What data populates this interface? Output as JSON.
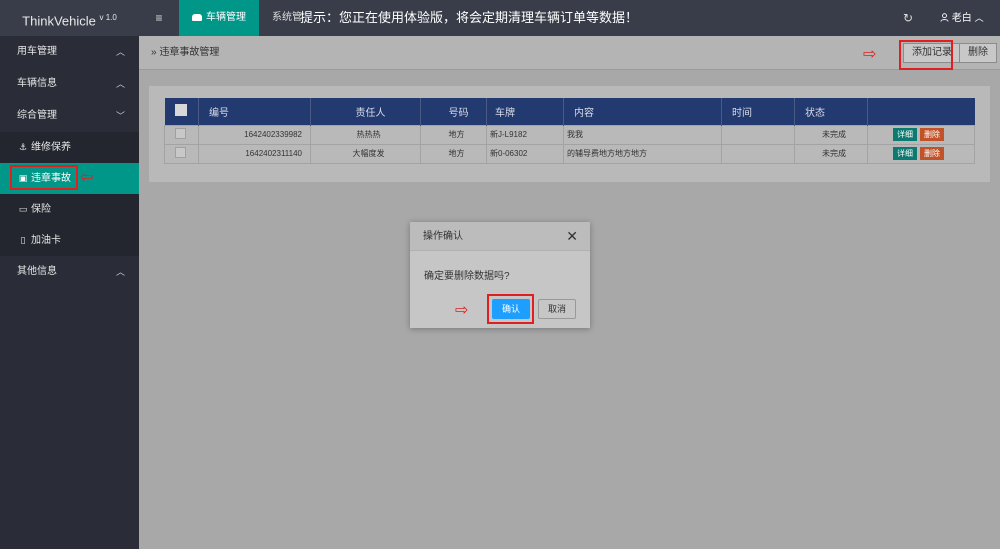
{
  "header": {
    "brand": "ThinkVehicle",
    "version": "v 1.0",
    "menu_icon": "≡",
    "active_tab": "车辆管理",
    "tab_sys": "系统管",
    "notice": "提示：您正在使用体验版，将会定期清理车辆订单等数据！",
    "refresh_icon": "↻",
    "user_name": "老白",
    "user_icon": "user-icon"
  },
  "sidebar": {
    "groups": [
      {
        "label": "用车管理",
        "chev": "︿"
      },
      {
        "label": "车辆信息",
        "chev": "︿"
      },
      {
        "label": "综合管理",
        "chev": "﹀"
      }
    ],
    "subs": [
      {
        "label": "维修保养",
        "icon": "⚓"
      },
      {
        "label": "违章事故",
        "icon": "▣"
      },
      {
        "label": "保险",
        "icon": "▭"
      },
      {
        "label": "加油卡",
        "icon": "▯"
      }
    ],
    "other": {
      "label": "其他信息",
      "chev": "︿"
    }
  },
  "breadcrumb": {
    "prefix": "»",
    "title": "违章事故管理"
  },
  "toolbar": {
    "add_label": "添加记录",
    "delete_label": "删除"
  },
  "table": {
    "headers": [
      "编号",
      "责任人",
      "号码",
      "车牌",
      "内容",
      "时间",
      "状态"
    ],
    "rows": [
      {
        "id": "1642402339982",
        "person": "热热热",
        "number": "地方",
        "plate": "新J-L9182",
        "content": "我我",
        "time": "",
        "status": "未完成"
      },
      {
        "id": "1642402311140",
        "person": "大幅度发",
        "number": "地方",
        "plate": "新0-06302",
        "content": "的辅导费地方地方地方",
        "time": "",
        "status": "未完成"
      }
    ],
    "detail_label": "详细",
    "delete_label": "删除"
  },
  "modal": {
    "title": "操作确认",
    "close": "✕",
    "message": "确定要删除数据吗?",
    "ok": "确认",
    "cancel": "取消"
  },
  "colors": {
    "accent": "#009688",
    "danger": "#e02020",
    "primary": "#1e9fff",
    "table_header": "#233a70"
  }
}
